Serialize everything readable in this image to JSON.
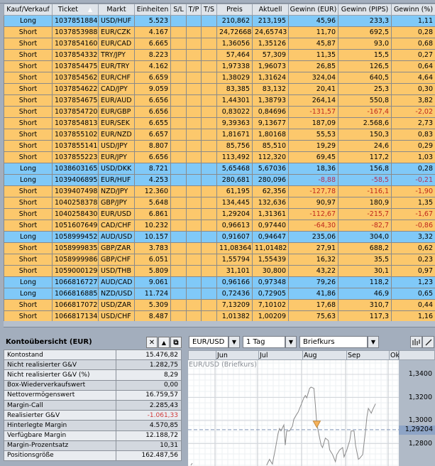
{
  "positions": {
    "columns": [
      "Kauf/Verkauf",
      "Ticket",
      "Markt",
      "Einheiten",
      "S/L",
      "T/P",
      "T/S",
      "Preis",
      "Aktuell",
      "Gewinn (EUR)",
      "Gewinn (PIPS)",
      "Gewinn (%)"
    ],
    "sort_indicator": "▲",
    "rows": [
      [
        "Long",
        "1037851884",
        "USD/HUF",
        "5.523",
        "",
        "",
        "",
        "210,862",
        "213,195",
        "45,96",
        "233,3",
        "1,11"
      ],
      [
        "Short",
        "1037853988",
        "EUR/CZK",
        "4.167",
        "",
        "",
        "",
        "24,72668",
        "24,65743",
        "11,70",
        "692,5",
        "0,28"
      ],
      [
        "Short",
        "1037854160",
        "EUR/CAD",
        "6.665",
        "",
        "",
        "",
        "1,36056",
        "1,35126",
        "45,87",
        "93,0",
        "0,68"
      ],
      [
        "Short",
        "1037854332",
        "TRY/JPY",
        "8.223",
        "",
        "",
        "",
        "57,464",
        "57,309",
        "11,35",
        "15,5",
        "0,27"
      ],
      [
        "Short",
        "1037854475",
        "EUR/TRY",
        "4.162",
        "",
        "",
        "",
        "1,97338",
        "1,96073",
        "26,85",
        "126,5",
        "0,64"
      ],
      [
        "Short",
        "1037854562",
        "EUR/CHF",
        "6.659",
        "",
        "",
        "",
        "1,38029",
        "1,31624",
        "324,04",
        "640,5",
        "4,64"
      ],
      [
        "Short",
        "1037854622",
        "CAD/JPY",
        "9.059",
        "",
        "",
        "",
        "83,385",
        "83,132",
        "20,41",
        "25,3",
        "0,30"
      ],
      [
        "Short",
        "1037854675",
        "EUR/AUD",
        "6.656",
        "",
        "",
        "",
        "1,44301",
        "1,38793",
        "264,14",
        "550,8",
        "3,82"
      ],
      [
        "Short",
        "1037854720",
        "EUR/GBP",
        "6.656",
        "",
        "",
        "",
        "0,83022",
        "0,84696",
        "-131,57",
        "-167,4",
        "-2,02"
      ],
      [
        "Short",
        "1037854813",
        "EUR/SEK",
        "6.655",
        "",
        "",
        "",
        "9,39363",
        "9,13677",
        "187,09",
        "2.568,6",
        "2,73"
      ],
      [
        "Short",
        "1037855102",
        "EUR/NZD",
        "6.657",
        "",
        "",
        "",
        "1,81671",
        "1,80168",
        "55,53",
        "150,3",
        "0,83"
      ],
      [
        "Short",
        "1037855141",
        "USD/JPY",
        "8.807",
        "",
        "",
        "",
        "85,756",
        "85,510",
        "19,29",
        "24,6",
        "0,29"
      ],
      [
        "Short",
        "1037855223",
        "EUR/JPY",
        "6.656",
        "",
        "",
        "",
        "113,492",
        "112,320",
        "69,45",
        "117,2",
        "1,03"
      ],
      [
        "Long",
        "1038603165",
        "USD/DKK",
        "8.721",
        "",
        "",
        "",
        "5,65468",
        "5,67036",
        "18,36",
        "156,8",
        "0,28"
      ],
      [
        "Long",
        "1039406895",
        "EUR/HUF",
        "4.253",
        "",
        "",
        "",
        "280,681",
        "280,096",
        "-8,88",
        "-58,5",
        "-0,21"
      ],
      [
        "Short",
        "1039407498",
        "NZD/JPY",
        "12.360",
        "",
        "",
        "",
        "61,195",
        "62,356",
        "-127,78",
        "-116,1",
        "-1,90"
      ],
      [
        "Short",
        "1040258378",
        "GBP/JPY",
        "5.648",
        "",
        "",
        "",
        "134,445",
        "132,636",
        "90,97",
        "180,9",
        "1,35"
      ],
      [
        "Short",
        "1040258430",
        "EUR/USD",
        "6.861",
        "",
        "",
        "",
        "1,29204",
        "1,31361",
        "-112,67",
        "-215,7",
        "-1,67"
      ],
      [
        "Short",
        "1051607649",
        "CAD/CHF",
        "10.232",
        "",
        "",
        "",
        "0,96613",
        "0,97440",
        "-64,30",
        "-82,7",
        "-0,86"
      ],
      [
        "Long",
        "1058999452",
        "AUD/USD",
        "10.157",
        "",
        "",
        "",
        "0,91607",
        "0,94647",
        "235,06",
        "304,0",
        "3,32"
      ],
      [
        "Short",
        "1058999835",
        "GBP/ZAR",
        "3.783",
        "",
        "",
        "",
        "11,08364",
        "11,01482",
        "27,91",
        "688,2",
        "0,62"
      ],
      [
        "Short",
        "1058999986",
        "GBP/CHF",
        "6.051",
        "",
        "",
        "",
        "1,55794",
        "1,55439",
        "16,32",
        "35,5",
        "0,23"
      ],
      [
        "Short",
        "1059000129",
        "USD/THB",
        "5.809",
        "",
        "",
        "",
        "31,101",
        "30,800",
        "43,22",
        "30,1",
        "0,97"
      ],
      [
        "Long",
        "1066816727",
        "AUD/CAD",
        "9.061",
        "",
        "",
        "",
        "0,96166",
        "0,97348",
        "79,26",
        "118,2",
        "1,23"
      ],
      [
        "Long",
        "1066816885",
        "NZD/USD",
        "11.724",
        "",
        "",
        "",
        "0,72436",
        "0,72905",
        "41,86",
        "46,9",
        "0,65"
      ],
      [
        "Short",
        "1066817072",
        "USD/ZAR",
        "5.309",
        "",
        "",
        "",
        "7,13209",
        "7,10102",
        "17,68",
        "310,7",
        "0,44"
      ],
      [
        "Short",
        "1066817134",
        "USD/CHF",
        "8.487",
        "",
        "",
        "",
        "1,01382",
        "1,00209",
        "75,63",
        "117,3",
        "1,16"
      ]
    ]
  },
  "account": {
    "title": "Kontoübersicht (EUR)",
    "buttons": {
      "close": "✕",
      "collapse": "▲",
      "detach": "⧉"
    },
    "rows": [
      [
        "Kontostand",
        "15.476,82"
      ],
      [
        "Nicht realisierter G&V",
        "1.282,75"
      ],
      [
        "Nicht realisierter G&V (%)",
        "8,29"
      ],
      [
        "Box-Wiederverkaufswert",
        "0,00"
      ],
      [
        "Nettovermögenswert",
        "16.759,57"
      ],
      [
        "Margin-Call",
        "2.285,43"
      ],
      [
        "Realisierter G&V",
        "-1.061,33"
      ],
      [
        "Hinterlegte Margin",
        "4.570,85"
      ],
      [
        "Verfügbare Margin",
        "12.188,72"
      ],
      [
        "Margin-Prozentsatz",
        "10,31"
      ],
      [
        "Positionsgröße",
        "162.487,56"
      ]
    ]
  },
  "chart": {
    "instrument": "EUR/USD",
    "interval": "1 Tag",
    "price_type": "Briefkurs",
    "tool_icons": [
      "candlestick-icon",
      "draw-line-icon"
    ]
  },
  "colors": {
    "long": "#80c9f8",
    "short": "#fcc86c",
    "negative": "#c0281c",
    "line": "#8a8a8a",
    "marker": "#f6b25a"
  },
  "chart_data": {
    "type": "line",
    "title": "EUR/USD (Briefkurs)",
    "x_ticks": [
      "Jun",
      "Jul",
      "Aug",
      "Sep",
      "Ok"
    ],
    "y_ticks": [
      "1,3400",
      "1,3200",
      "1,3000",
      "1,2800"
    ],
    "ylim": [
      1.258,
      1.358
    ],
    "grid": true,
    "current_price_label": "1,29204",
    "current_price": 1.29204,
    "marker": {
      "x": "08-11",
      "y": 1.2971,
      "kind": "short-entry"
    },
    "x": [
      "07-07",
      "07-09",
      "07-11",
      "07-13",
      "07-15",
      "07-16",
      "07-17",
      "07-19",
      "07-20",
      "07-21",
      "07-23",
      "07-25",
      "07-26",
      "07-28",
      "07-29",
      "07-31",
      "08-02",
      "08-03",
      "08-04",
      "08-05",
      "08-06",
      "08-07",
      "08-09",
      "08-10",
      "08-11",
      "08-12",
      "08-14",
      "08-15",
      "08-17",
      "08-19",
      "08-20",
      "08-22",
      "08-24",
      "08-25",
      "08-27",
      "08-29",
      "08-30",
      "09-01",
      "09-03",
      "09-04",
      "09-06",
      "09-07",
      "09-09",
      "09-10",
      "09-12",
      "09-14",
      "09-15",
      "09-16",
      "09-18",
      "09-19",
      "09-21"
    ],
    "y": [
      1.2613,
      1.2664,
      1.2623,
      1.2746,
      1.2889,
      1.2931,
      1.291,
      1.2961,
      1.2787,
      1.291,
      1.291,
      1.2951,
      1.3012,
      1.3054,
      1.3074,
      1.3135,
      1.3197,
      1.3217,
      1.3197,
      1.3238,
      1.3279,
      1.3289,
      1.3279,
      1.3135,
      1.2971,
      1.291,
      1.2787,
      1.2766,
      1.2848,
      1.2828,
      1.2746,
      1.2705,
      1.2644,
      1.2705,
      1.2746,
      1.2766,
      1.2685,
      1.2746,
      1.2828,
      1.291,
      1.291,
      1.2787,
      1.2664,
      1.2674,
      1.2705,
      1.291,
      1.3033,
      1.3105,
      1.3064,
      1.3094,
      1.3146
    ]
  }
}
